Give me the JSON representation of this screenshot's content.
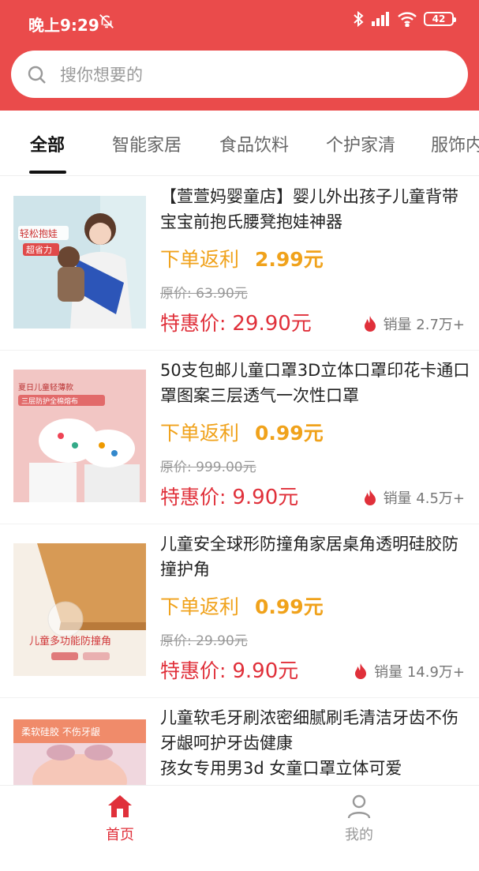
{
  "status_bar": {
    "time": "晚上9:29",
    "battery": "42"
  },
  "search": {
    "placeholder": "搜你想要的"
  },
  "tabs": [
    "全部",
    "智能家居",
    "食品饮料",
    "个护家清",
    "服饰内衣"
  ],
  "colors": {
    "brand": "#ea4b4b",
    "rebate": "#f0a21b",
    "price": "#e0303a"
  },
  "products": [
    {
      "title": "【萱萱妈婴童店】婴儿外出孩子儿童背带宝宝前抱氏腰凳抱娃神器",
      "rebate_label": "下单返利",
      "rebate_value": "2.99元",
      "original_price": "原价: 63.90元",
      "deal_label": "特惠价: ",
      "deal_price": "29.90元",
      "sales": "销量 2.7万+",
      "image_text": [
        "轻松抱娃",
        "超省力"
      ]
    },
    {
      "title": "50支包邮儿童口罩3D立体口罩印花卡通口罩图案三层透气一次性口罩",
      "rebate_label": "下单返利",
      "rebate_value": "0.99元",
      "original_price": "原价: 999.00元",
      "deal_label": "特惠价: ",
      "deal_price": "9.90元",
      "sales": "销量 4.5万+",
      "image_text": [
        "夏日儿童轻薄款",
        "三层防护全棉熔布"
      ]
    },
    {
      "title": "儿童安全球形防撞角家居桌角透明硅胶防撞护角",
      "rebate_label": "下单返利",
      "rebate_value": "0.99元",
      "original_price": "原价: 29.90元",
      "deal_label": "特惠价: ",
      "deal_price": "9.90元",
      "sales": "销量 14.9万+",
      "image_text": [
        "儿童多功能防撞角"
      ]
    },
    {
      "title": "儿童软毛牙刷浓密细腻刷毛清洁牙齿不伤牙龈呵护牙齿健康",
      "title2": "孩女专用男3d 女童口罩立体可爱",
      "image_text": [
        "柔软硅胶 不伤牙龈"
      ]
    }
  ],
  "bottom_nav": [
    {
      "label": "首页",
      "icon": "home-icon",
      "active": true
    },
    {
      "label": "我的",
      "icon": "user-icon",
      "active": false
    }
  ]
}
